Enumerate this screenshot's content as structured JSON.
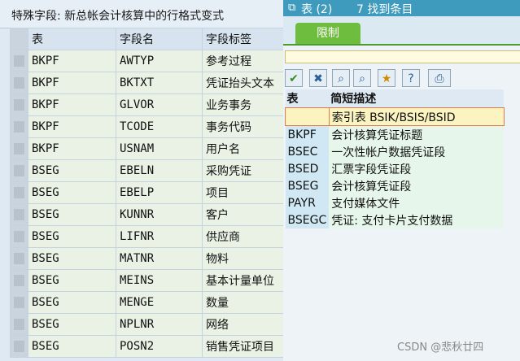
{
  "background": {
    "title": "特殊字段: 新总帐会计核算中的行格式变式",
    "columns": [
      "表",
      "字段名",
      "字段标签"
    ],
    "rows": [
      {
        "table": "BKPF",
        "field": "AWTYP",
        "label": "参考过程"
      },
      {
        "table": "BKPF",
        "field": "BKTXT",
        "label": "凭证抬头文本"
      },
      {
        "table": "BKPF",
        "field": "GLVOR",
        "label": "业务事务"
      },
      {
        "table": "BKPF",
        "field": "TCODE",
        "label": "事务代码"
      },
      {
        "table": "BKPF",
        "field": "USNAM",
        "label": "用户名"
      },
      {
        "table": "BSEG",
        "field": "EBELN",
        "label": "采购凭证"
      },
      {
        "table": "BSEG",
        "field": "EBELP",
        "label": "项目"
      },
      {
        "table": "BSEG",
        "field": "KUNNR",
        "label": "客户"
      },
      {
        "table": "BSEG",
        "field": "LIFNR",
        "label": "供应商"
      },
      {
        "table": "BSEG",
        "field": "MATNR",
        "label": "物料"
      },
      {
        "table": "BSEG",
        "field": "MEINS",
        "label": "基本计量单位"
      },
      {
        "table": "BSEG",
        "field": "MENGE",
        "label": "数量"
      },
      {
        "table": "BSEG",
        "field": "NPLNR",
        "label": "网络"
      },
      {
        "table": "BSEG",
        "field": "POSN2",
        "label": "销售凭证项目"
      }
    ]
  },
  "popup": {
    "title": "表 (2)",
    "found": "7 找到条目",
    "tab_label": "限制",
    "input_value": "",
    "toolbar_icons": [
      "checkmark-icon",
      "close-icon",
      "binoculars-icon",
      "binoculars-next-icon",
      "favorite-add-icon",
      "help-icon",
      "print-icon"
    ],
    "columns": [
      "表",
      "简短描述"
    ],
    "rows": [
      {
        "table": "",
        "desc": "索引表 BSIK/BSIS/BSID"
      },
      {
        "table": "BKPF",
        "desc": "会计核算凭证标题"
      },
      {
        "table": "BSEC",
        "desc": "一次性帐户数据凭证段"
      },
      {
        "table": "BSED",
        "desc": "汇票字段凭证段"
      },
      {
        "table": "BSEG",
        "desc": "会计核算凭证段"
      },
      {
        "table": "PAYR",
        "desc": "支付媒体文件"
      },
      {
        "table": "BSEGC",
        "desc": "凭证: 支付卡片支付数据"
      }
    ]
  },
  "watermark": "CSDN @悲秋廿四",
  "colors": {
    "title_bar": "#3f9bbd",
    "tab": "#6fbd3f",
    "row_green": "#e9f2e4"
  }
}
